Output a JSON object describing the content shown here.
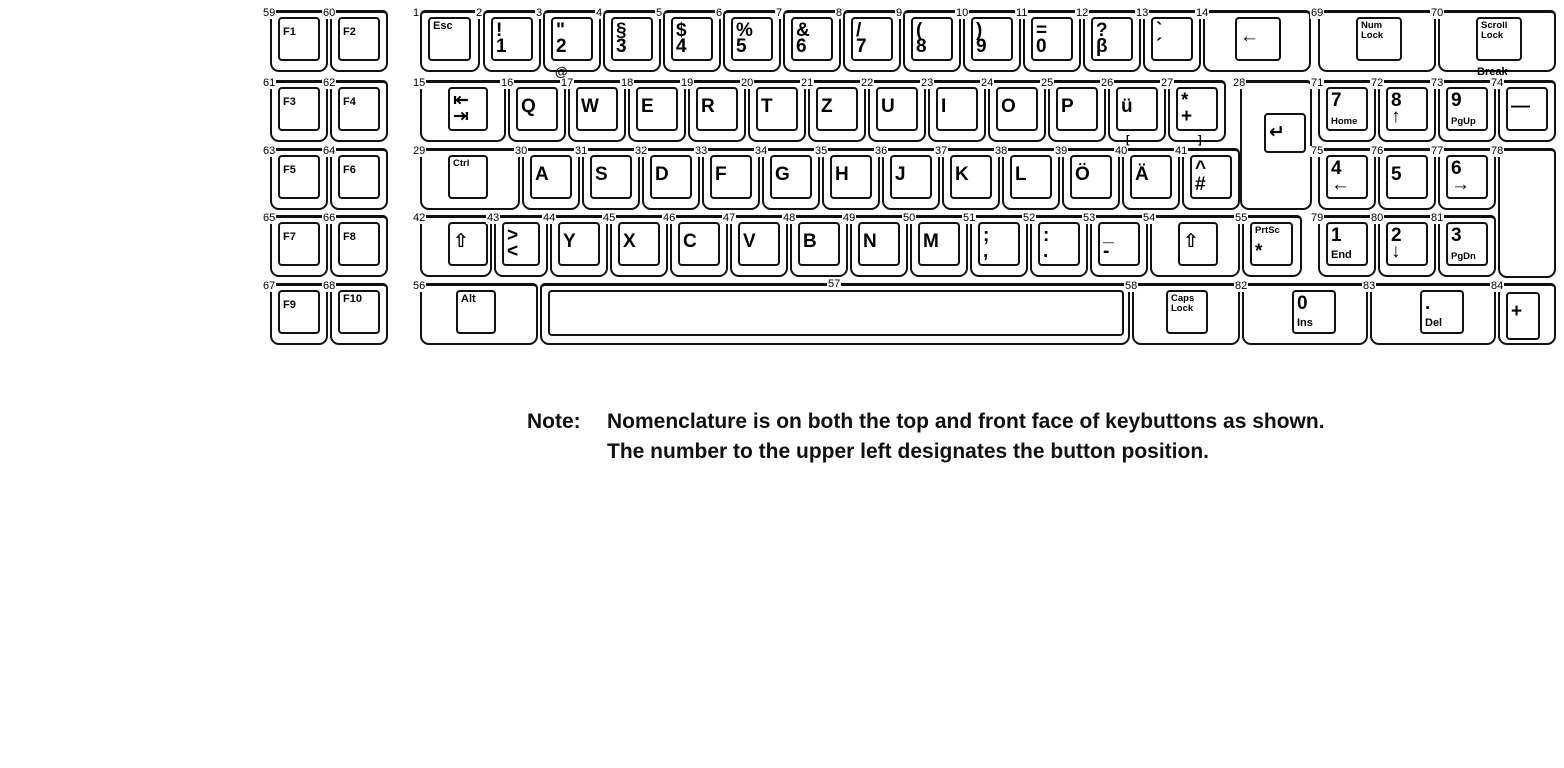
{
  "keyboard": {
    "keys": [
      {
        "pos": "59",
        "top": "F1",
        "bottom": ""
      },
      {
        "pos": "60",
        "top": "F2",
        "bottom": ""
      },
      {
        "pos": "61",
        "top": "F3",
        "bottom": ""
      },
      {
        "pos": "62",
        "top": "F4",
        "bottom": ""
      },
      {
        "pos": "63",
        "top": "F5",
        "bottom": ""
      },
      {
        "pos": "64",
        "top": "F6",
        "bottom": ""
      },
      {
        "pos": "65",
        "top": "F7",
        "bottom": ""
      },
      {
        "pos": "66",
        "top": "F8",
        "bottom": ""
      },
      {
        "pos": "67",
        "top": "F9",
        "bottom": ""
      },
      {
        "pos": "68",
        "top": "F10",
        "bottom": ""
      },
      {
        "pos": "1",
        "top": "Esc",
        "bottom": ""
      },
      {
        "pos": "2",
        "top": "!",
        "bottom": "1"
      },
      {
        "pos": "3",
        "top": "\"",
        "bottom": "2"
      },
      {
        "pos": "4",
        "top": "§",
        "bottom": "3"
      },
      {
        "pos": "5",
        "top": "$",
        "bottom": "4"
      },
      {
        "pos": "6",
        "top": "%",
        "bottom": "5"
      },
      {
        "pos": "7",
        "top": "&",
        "bottom": "6"
      },
      {
        "pos": "8",
        "top": "/",
        "bottom": "7"
      },
      {
        "pos": "9",
        "top": "(",
        "bottom": "8"
      },
      {
        "pos": "10",
        "top": ")",
        "bottom": "9"
      },
      {
        "pos": "11",
        "top": "=",
        "bottom": "0"
      },
      {
        "pos": "12",
        "top": "?",
        "bottom": "β"
      },
      {
        "pos": "13",
        "top": "`",
        "bottom": "´"
      },
      {
        "pos": "14",
        "top": "←",
        "bottom": ""
      },
      {
        "pos": "69",
        "top": "Num\nLock",
        "bottom": ""
      },
      {
        "pos": "70",
        "top": "Scroll\nLock",
        "bottom": ""
      },
      {
        "pos": "15",
        "top": "⇤",
        "bottom": "⇥"
      },
      {
        "pos": "16",
        "top": "Q",
        "bottom": ""
      },
      {
        "pos": "17",
        "top": "W",
        "bottom": ""
      },
      {
        "pos": "18",
        "top": "E",
        "bottom": ""
      },
      {
        "pos": "19",
        "top": "R",
        "bottom": ""
      },
      {
        "pos": "20",
        "top": "T",
        "bottom": ""
      },
      {
        "pos": "21",
        "top": "Z",
        "bottom": ""
      },
      {
        "pos": "22",
        "top": "U",
        "bottom": ""
      },
      {
        "pos": "23",
        "top": "I",
        "bottom": ""
      },
      {
        "pos": "24",
        "top": "O",
        "bottom": ""
      },
      {
        "pos": "25",
        "top": "P",
        "bottom": ""
      },
      {
        "pos": "26",
        "top": "ü",
        "bottom": ""
      },
      {
        "pos": "27",
        "top": "*",
        "bottom": "+"
      },
      {
        "pos": "28",
        "top": "↵",
        "bottom": ""
      },
      {
        "pos": "71",
        "top": "7",
        "bottom": "Home"
      },
      {
        "pos": "72",
        "top": "8",
        "bottom": "↑"
      },
      {
        "pos": "73",
        "top": "9",
        "bottom": "PgUp"
      },
      {
        "pos": "74",
        "top": "—",
        "bottom": ""
      },
      {
        "pos": "29",
        "top": "Ctrl",
        "bottom": ""
      },
      {
        "pos": "30",
        "top": "A",
        "bottom": ""
      },
      {
        "pos": "31",
        "top": "S",
        "bottom": ""
      },
      {
        "pos": "32",
        "top": "D",
        "bottom": ""
      },
      {
        "pos": "33",
        "top": "F",
        "bottom": ""
      },
      {
        "pos": "34",
        "top": "G",
        "bottom": ""
      },
      {
        "pos": "35",
        "top": "H",
        "bottom": ""
      },
      {
        "pos": "36",
        "top": "J",
        "bottom": ""
      },
      {
        "pos": "37",
        "top": "K",
        "bottom": ""
      },
      {
        "pos": "38",
        "top": "L",
        "bottom": ""
      },
      {
        "pos": "39",
        "top": "Ö",
        "bottom": ""
      },
      {
        "pos": "40",
        "top": "Ä",
        "bottom": ""
      },
      {
        "pos": "41",
        "top": "^",
        "bottom": "#"
      },
      {
        "pos": "75",
        "top": "4",
        "bottom": "←"
      },
      {
        "pos": "76",
        "top": "5",
        "bottom": ""
      },
      {
        "pos": "77",
        "top": "6",
        "bottom": "→"
      },
      {
        "pos": "78",
        "top": "",
        "bottom": ""
      },
      {
        "pos": "42",
        "top": "⇧",
        "bottom": ""
      },
      {
        "pos": "43",
        "top": ">",
        "bottom": "<"
      },
      {
        "pos": "44",
        "top": "Y",
        "bottom": ""
      },
      {
        "pos": "45",
        "top": "X",
        "bottom": ""
      },
      {
        "pos": "46",
        "top": "C",
        "bottom": ""
      },
      {
        "pos": "47",
        "top": "V",
        "bottom": ""
      },
      {
        "pos": "48",
        "top": "B",
        "bottom": ""
      },
      {
        "pos": "49",
        "top": "N",
        "bottom": ""
      },
      {
        "pos": "50",
        "top": "M",
        "bottom": ""
      },
      {
        "pos": "51",
        "top": ";",
        "bottom": ","
      },
      {
        "pos": "52",
        "top": ":",
        "bottom": "."
      },
      {
        "pos": "53",
        "top": "_",
        "bottom": "-"
      },
      {
        "pos": "54",
        "top": "⇧",
        "bottom": ""
      },
      {
        "pos": "55",
        "top": "PrtSc",
        "bottom": "*"
      },
      {
        "pos": "79",
        "top": "1",
        "bottom": "End"
      },
      {
        "pos": "80",
        "top": "2",
        "bottom": "↓"
      },
      {
        "pos": "81",
        "top": "3",
        "bottom": "PgDn"
      },
      {
        "pos": "56",
        "top": "Alt",
        "bottom": ""
      },
      {
        "pos": "57",
        "top": "",
        "bottom": ""
      },
      {
        "pos": "58",
        "top": "Caps\nLock",
        "bottom": ""
      },
      {
        "pos": "82",
        "top": "0",
        "bottom": "Ins"
      },
      {
        "pos": "83",
        "top": ".",
        "bottom": "Del"
      },
      {
        "pos": "84",
        "top": "+",
        "bottom": ""
      }
    ],
    "extra_labels": {
      "at_sign": "@",
      "break": "Break",
      "bracket_open": "[",
      "bracket_close": "]"
    }
  },
  "note": {
    "title": "Note:",
    "text": "Nomenclature is on both the top and front face of keybuttons as shown. The number to the upper left designates the button position."
  }
}
